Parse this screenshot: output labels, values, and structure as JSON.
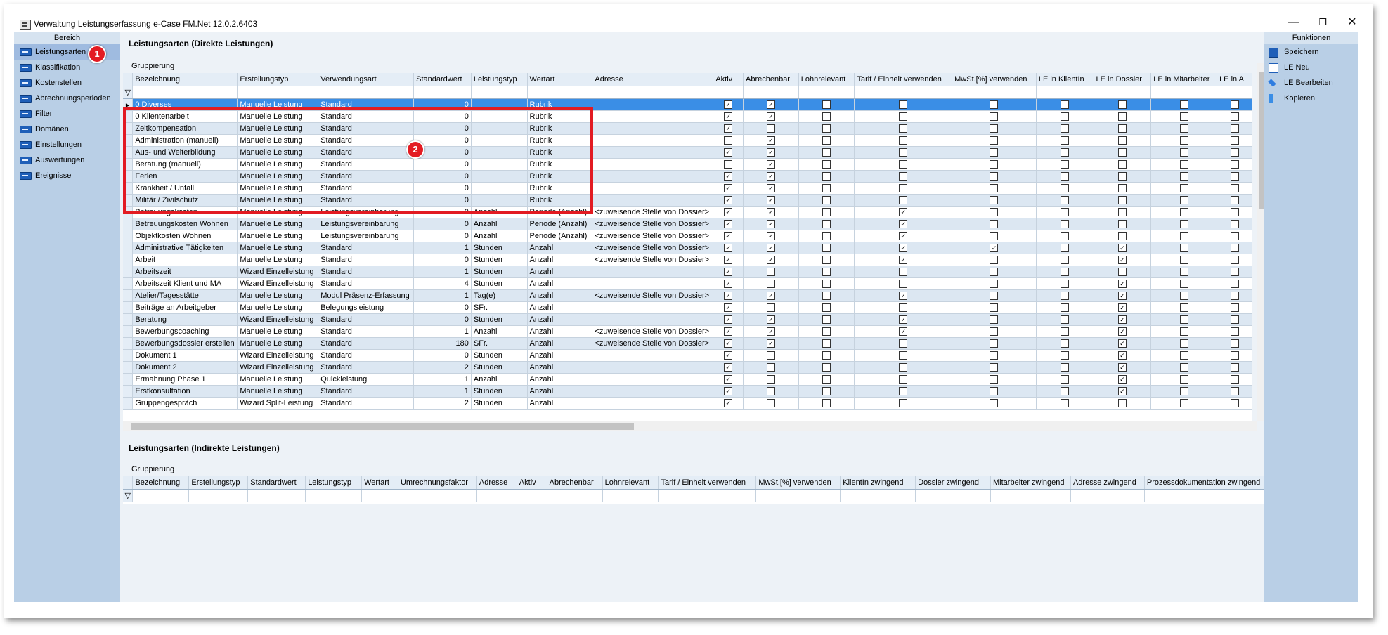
{
  "window": {
    "title": "Verwaltung Leistungserfassung e-Case FM.Net 12.0.2.6403",
    "minimize_glyph": "—",
    "restore_glyph": "❐",
    "close_glyph": "✕"
  },
  "left_panel": {
    "header": "Bereich",
    "items": [
      {
        "label": "Leistungsarten",
        "icon": "list-icon"
      },
      {
        "label": "Klassifikation",
        "icon": "list-icon"
      },
      {
        "label": "Kostenstellen",
        "icon": "list-icon"
      },
      {
        "label": "Abrechnungsperioden",
        "icon": "list-icon"
      },
      {
        "label": "Filter",
        "icon": "list-icon"
      },
      {
        "label": "Domänen",
        "icon": "list-icon"
      },
      {
        "label": "Einstellungen",
        "icon": "list-icon"
      },
      {
        "label": "Auswertungen",
        "icon": "list-icon"
      },
      {
        "label": "Ereignisse",
        "icon": "list-icon"
      }
    ]
  },
  "callouts": {
    "one": "1",
    "two": "2"
  },
  "colors": {
    "accent_red": "#e21b22",
    "selected_row": "#3a8ee6",
    "panel": "#b9cfe6"
  },
  "direct": {
    "title": "Leistungsarten (Direkte Leistungen)",
    "grouping": "Gruppierung",
    "filter_icon": "funnel-icon",
    "columns": [
      "Bezeichnung",
      "Erstellungstyp",
      "Verwendungsart",
      "Standardwert",
      "Leistungstyp",
      "Wertart",
      "Adresse",
      "Aktiv",
      "Abrechenbar",
      "Lohnrelevant",
      "Tarif / Einheit verwenden",
      "MwSt.[%] verwenden",
      "LE in KlientIn",
      "LE in Dossier",
      "LE in Mitarbeiter",
      "LE in A"
    ],
    "rows": [
      {
        "name": "0 Diverses",
        "typ": "Manuelle Leistung",
        "verw": "Standard",
        "std": "0",
        "ltyp": "",
        "wert": "Rubrik",
        "adr": "",
        "checks": [
          1,
          1,
          0,
          0,
          0,
          0,
          0,
          0
        ]
      },
      {
        "name": "0 Klientenarbeit",
        "typ": "Manuelle Leistung",
        "verw": "Standard",
        "std": "0",
        "ltyp": "",
        "wert": "Rubrik",
        "adr": "",
        "checks": [
          1,
          1,
          0,
          0,
          0,
          0,
          0,
          0
        ]
      },
      {
        "name": "Zeitkompensation",
        "typ": "Manuelle Leistung",
        "verw": "Standard",
        "std": "0",
        "ltyp": "",
        "wert": "Rubrik",
        "adr": "",
        "checks": [
          1,
          0,
          0,
          0,
          0,
          0,
          0,
          0
        ]
      },
      {
        "name": "Administration (manuell)",
        "typ": "Manuelle Leistung",
        "verw": "Standard",
        "std": "0",
        "ltyp": "",
        "wert": "Rubrik",
        "adr": "",
        "checks": [
          0,
          1,
          0,
          0,
          0,
          0,
          0,
          0
        ]
      },
      {
        "name": "Aus- und Weiterbildung",
        "typ": "Manuelle Leistung",
        "verw": "Standard",
        "std": "0",
        "ltyp": "",
        "wert": "Rubrik",
        "adr": "",
        "checks": [
          1,
          1,
          0,
          0,
          0,
          0,
          0,
          0
        ]
      },
      {
        "name": "Beratung (manuell)",
        "typ": "Manuelle Leistung",
        "verw": "Standard",
        "std": "0",
        "ltyp": "",
        "wert": "Rubrik",
        "adr": "",
        "checks": [
          0,
          1,
          0,
          0,
          0,
          0,
          0,
          0
        ]
      },
      {
        "name": "Ferien",
        "typ": "Manuelle Leistung",
        "verw": "Standard",
        "std": "0",
        "ltyp": "",
        "wert": "Rubrik",
        "adr": "",
        "checks": [
          1,
          1,
          0,
          0,
          0,
          0,
          0,
          0
        ]
      },
      {
        "name": "Krankheit / Unfall",
        "typ": "Manuelle Leistung",
        "verw": "Standard",
        "std": "0",
        "ltyp": "",
        "wert": "Rubrik",
        "adr": "",
        "checks": [
          1,
          1,
          0,
          0,
          0,
          0,
          0,
          0
        ]
      },
      {
        "name": "Militär / Zivilschutz",
        "typ": "Manuelle Leistung",
        "verw": "Standard",
        "std": "0",
        "ltyp": "",
        "wert": "Rubrik",
        "adr": "",
        "checks": [
          1,
          1,
          0,
          0,
          0,
          0,
          0,
          0
        ]
      },
      {
        "name": "Betreuungskosten",
        "typ": "Manuelle Leistung",
        "verw": "Leistungsvereinbarung",
        "std": "0",
        "ltyp": "Anzahl",
        "wert": "Periode (Anzahl)",
        "adr": "<zuweisende Stelle von Dossier>",
        "checks": [
          1,
          1,
          0,
          1,
          0,
          0,
          0,
          0
        ]
      },
      {
        "name": "Betreuungskosten Wohnen",
        "typ": "Manuelle Leistung",
        "verw": "Leistungsvereinbarung",
        "std": "0",
        "ltyp": "Anzahl",
        "wert": "Periode (Anzahl)",
        "adr": "<zuweisende Stelle von Dossier>",
        "checks": [
          1,
          1,
          0,
          1,
          0,
          0,
          0,
          0
        ]
      },
      {
        "name": "Objektkosten Wohnen",
        "typ": "Manuelle Leistung",
        "verw": "Leistungsvereinbarung",
        "std": "0",
        "ltyp": "Anzahl",
        "wert": "Periode (Anzahl)",
        "adr": "<zuweisende Stelle von Dossier>",
        "checks": [
          1,
          1,
          0,
          1,
          0,
          0,
          0,
          0
        ]
      },
      {
        "name": "Administrative Tätigkeiten",
        "typ": "Manuelle Leistung",
        "verw": "Standard",
        "std": "1",
        "ltyp": "Stunden",
        "wert": "Anzahl",
        "adr": "<zuweisende Stelle von Dossier>",
        "checks": [
          1,
          1,
          0,
          1,
          1,
          0,
          1,
          0
        ]
      },
      {
        "name": "Arbeit",
        "typ": "Manuelle Leistung",
        "verw": "Standard",
        "std": "0",
        "ltyp": "Stunden",
        "wert": "Anzahl",
        "adr": "<zuweisende Stelle von Dossier>",
        "checks": [
          1,
          1,
          0,
          1,
          0,
          0,
          1,
          0
        ]
      },
      {
        "name": "Arbeitszeit",
        "typ": "Wizard Einzelleistung",
        "verw": "Standard",
        "std": "1",
        "ltyp": "Stunden",
        "wert": "Anzahl",
        "adr": "",
        "checks": [
          1,
          0,
          0,
          0,
          0,
          0,
          0,
          0
        ]
      },
      {
        "name": "Arbeitszeit Klient und MA",
        "typ": "Wizard Einzelleistung",
        "verw": "Standard",
        "std": "4",
        "ltyp": "Stunden",
        "wert": "Anzahl",
        "adr": "",
        "checks": [
          1,
          0,
          0,
          0,
          0,
          0,
          1,
          0
        ]
      },
      {
        "name": "Atelier/Tagesstätte",
        "typ": "Manuelle Leistung",
        "verw": "Modul Präsenz-Erfassung",
        "std": "1",
        "ltyp": "Tag(e)",
        "wert": "Anzahl",
        "adr": "<zuweisende Stelle von Dossier>",
        "checks": [
          1,
          1,
          0,
          1,
          0,
          0,
          1,
          0
        ]
      },
      {
        "name": "Beiträge an Arbeitgeber",
        "typ": "Manuelle Leistung",
        "verw": "Belegungsleistung",
        "std": "0",
        "ltyp": "SFr.",
        "wert": "Anzahl",
        "adr": "",
        "checks": [
          1,
          0,
          0,
          0,
          0,
          0,
          1,
          0
        ]
      },
      {
        "name": "Beratung",
        "typ": "Wizard Einzelleistung",
        "verw": "Standard",
        "std": "0",
        "ltyp": "Stunden",
        "wert": "Anzahl",
        "adr": "",
        "checks": [
          1,
          1,
          0,
          1,
          0,
          0,
          1,
          0
        ]
      },
      {
        "name": "Bewerbungscoaching",
        "typ": "Manuelle Leistung",
        "verw": "Standard",
        "std": "1",
        "ltyp": "Anzahl",
        "wert": "Anzahl",
        "adr": "<zuweisende Stelle von Dossier>",
        "checks": [
          1,
          1,
          0,
          1,
          0,
          0,
          1,
          0
        ]
      },
      {
        "name": "Bewerbungsdossier erstellen",
        "typ": "Manuelle Leistung",
        "verw": "Standard",
        "std": "180",
        "ltyp": "SFr.",
        "wert": "Anzahl",
        "adr": "<zuweisende Stelle von Dossier>",
        "checks": [
          1,
          1,
          0,
          0,
          0,
          0,
          1,
          0
        ]
      },
      {
        "name": "Dokument 1",
        "typ": "Wizard Einzelleistung",
        "verw": "Standard",
        "std": "0",
        "ltyp": "Stunden",
        "wert": "Anzahl",
        "adr": "",
        "checks": [
          1,
          0,
          0,
          0,
          0,
          0,
          1,
          0
        ]
      },
      {
        "name": "Dokument 2",
        "typ": "Wizard Einzelleistung",
        "verw": "Standard",
        "std": "2",
        "ltyp": "Stunden",
        "wert": "Anzahl",
        "adr": "",
        "checks": [
          1,
          0,
          0,
          0,
          0,
          0,
          1,
          0
        ]
      },
      {
        "name": "Ermahnung Phase 1",
        "typ": "Manuelle Leistung",
        "verw": "Quickleistung",
        "std": "1",
        "ltyp": "Anzahl",
        "wert": "Anzahl",
        "adr": "",
        "checks": [
          1,
          0,
          0,
          0,
          0,
          0,
          1,
          0
        ]
      },
      {
        "name": "Erstkonsultation",
        "typ": "Manuelle Leistung",
        "verw": "Standard",
        "std": "1",
        "ltyp": "Stunden",
        "wert": "Anzahl",
        "adr": "",
        "checks": [
          1,
          0,
          0,
          0,
          0,
          0,
          1,
          0
        ]
      },
      {
        "name": "Gruppengespräch",
        "typ": "Wizard Split-Leistung",
        "verw": "Standard",
        "std": "2",
        "ltyp": "Stunden",
        "wert": "Anzahl",
        "adr": "",
        "checks": [
          1,
          0,
          0,
          0,
          0,
          0,
          0,
          0
        ]
      }
    ]
  },
  "indirect": {
    "title": "Leistungsarten (Indirekte Leistungen)",
    "grouping": "Gruppierung",
    "columns": [
      "Bezeichnung",
      "Erstellungstyp",
      "Standardwert",
      "Leistungstyp",
      "Wertart",
      "Umrechnungsfaktor",
      "Adresse",
      "Aktiv",
      "Abrechenbar",
      "Lohnrelevant",
      "Tarif / Einheit verwenden",
      "MwSt.[%] verwenden",
      "KlientIn zwingend",
      "Dossier zwingend",
      "Mitarbeiter zwingend",
      "Adresse zwingend",
      "Prozessdokumentation zwingend"
    ]
  },
  "right_panel": {
    "header": "Funktionen",
    "items": [
      {
        "label": "Speichern",
        "icon": "save-icon"
      },
      {
        "label": "LE Neu",
        "icon": "new-icon"
      },
      {
        "label": "LE Bearbeiten",
        "icon": "edit-icon"
      },
      {
        "label": "Kopieren",
        "icon": "copy-icon"
      }
    ]
  }
}
